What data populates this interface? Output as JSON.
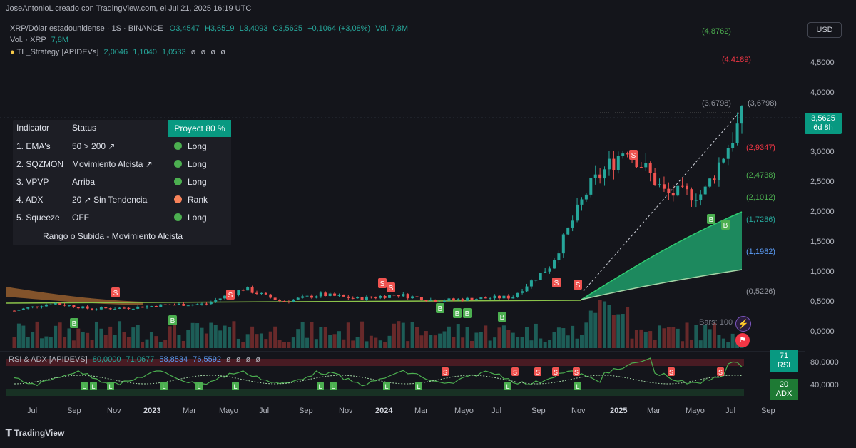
{
  "header": {
    "credit": "JoseAntonioL creado con TradingView.com, el Jul 21, 2025 16:19 UTC"
  },
  "legend": {
    "symbol": "XRP/Dólar estadounidense · 1S · BINANCE",
    "open": "O3,4547",
    "high": "H3,6519",
    "low": "L3,4093",
    "close": "C3,5625",
    "change": "+0,1064 (+3,08%)",
    "vol": "Vol. 7,8M",
    "vol_line_label": "Vol. · XRP",
    "vol_line_value": "7,8M",
    "strategy_label": "TL_Strategy [APIDEVs]",
    "strategy_values": [
      "2,0046",
      "1,1040",
      "1,0533",
      "ø",
      "ø",
      "ø",
      "ø"
    ]
  },
  "currency": "USD",
  "price_tag": {
    "price": "3,5625",
    "countdown": "6d 8h"
  },
  "y_axis": [
    "4,5000",
    "4,0000",
    "3,0000",
    "2,5000",
    "2,0000",
    "1,5000",
    "1,0000",
    "0,5000",
    "0,0000"
  ],
  "levels": [
    {
      "label": "(4,8762)",
      "color": "#4caf50",
      "value": 4.8762
    },
    {
      "label": "(4,4189)",
      "color": "#f23645",
      "value": 4.4189
    },
    {
      "label": "(3,6798)",
      "color": "#9598a1",
      "value": 3.6798
    },
    {
      "label": "(2,9347)",
      "color": "#f23645",
      "value": 2.9347
    },
    {
      "label": "(2,4738)",
      "color": "#4caf50",
      "value": 2.4738
    },
    {
      "label": "(2,1012)",
      "color": "#4caf50",
      "value": 2.1012
    },
    {
      "label": "(1,7286)",
      "color": "#26a69a",
      "value": 1.7286
    },
    {
      "label": "(1,1982)",
      "color": "#5b9cf6",
      "value": 1.1982
    },
    {
      "label": "(0,5226)",
      "color": "#9598a1",
      "value": 0.5226
    }
  ],
  "trend_top_label": "(3,6798)",
  "indicator_table": {
    "headers": [
      "Indicator",
      "Status"
    ],
    "projection": "Proyect 80 %",
    "rows": [
      {
        "name": "1. EMA's",
        "status": "50 > 200 ↗",
        "signal": "Long",
        "color": "#4caf50"
      },
      {
        "name": "2. SQZMON",
        "status": "Movimiento Alcista ↗",
        "signal": "Long",
        "color": "#4caf50"
      },
      {
        "name": "3. VPVP",
        "status": "Arriba",
        "signal": "Long",
        "color": "#4caf50"
      },
      {
        "name": "4. ADX",
        "status": "20 ↗ Sin Tendencia",
        "signal": "Rank",
        "color": "#f7835a"
      },
      {
        "name": "5. Squeeze",
        "status": "OFF",
        "signal": "Long",
        "color": "#4caf50"
      }
    ],
    "summary": "Rango o Subida - Movimiento Alcista"
  },
  "bars_label": "Bars: 100",
  "rsi_panel": {
    "label": "RSI & ADX [APIDEVS]",
    "values": [
      "80,0000",
      "71,0677",
      "58,8534",
      "76,5592",
      "ø",
      "ø",
      "ø",
      "ø"
    ],
    "y_axis": [
      "80,0000",
      "40,0000"
    ],
    "rsi_badge": {
      "value": "71",
      "label": "RSI"
    },
    "adx_badge": {
      "value": "20",
      "label": "ADX"
    }
  },
  "x_axis": [
    "Jul",
    "Sep",
    "Nov",
    "2023",
    "Mar",
    "Mayo",
    "Jul",
    "Sep",
    "Nov",
    "2024",
    "Mar",
    "Mayo",
    "Jul",
    "Sep",
    "Nov",
    "2025",
    "Mar",
    "Mayo",
    "Jul",
    "Sep"
  ],
  "footer": "TradingView",
  "chart_data": {
    "type": "candlestick",
    "title": "XRP/Dólar estadounidense · 1S · BINANCE",
    "timeframe": "1S",
    "ylim": [
      0,
      5
    ],
    "current_price": 3.5625,
    "ohlc_last": {
      "open": 3.4547,
      "high": 3.6519,
      "low": 3.4093,
      "close": 3.5625
    },
    "approx_weekly_closes": {
      "2022-07": 0.35,
      "2022-09": 0.48,
      "2022-11": 0.38,
      "2023-01": 0.4,
      "2023-03": 0.45,
      "2023-05": 0.46,
      "2023-07": 0.72,
      "2023-09": 0.5,
      "2023-11": 0.62,
      "2024-01": 0.55,
      "2024-03": 0.62,
      "2024-05": 0.52,
      "2024-07": 0.55,
      "2024-09": 0.58,
      "2024-11": 1.1,
      "2024-12": 2.4,
      "2025-01": 3.1,
      "2025-03": 2.3,
      "2025-05": 2.3,
      "2025-07": 3.56
    },
    "signals": {
      "buy": [
        "2022-09",
        "2023-01",
        "2024-04",
        "2024-05",
        "2024-05",
        "2024-08",
        "2025-05",
        "2025-06"
      ],
      "sell": [
        "2022-11",
        "2023-05",
        "2024-01",
        "2024-02",
        "2024-10",
        "2024-11",
        "2025-01"
      ]
    }
  }
}
